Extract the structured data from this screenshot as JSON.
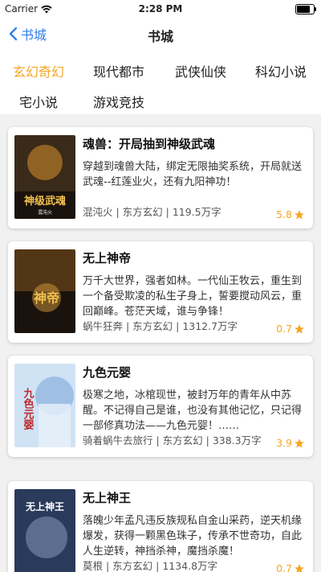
{
  "status": {
    "carrier": "Carrier",
    "time": "2:28 PM",
    "battery_level": 0.9
  },
  "nav": {
    "back_label": "书城",
    "title": "书城"
  },
  "categories": [
    {
      "label": "玄幻奇幻",
      "active": true
    },
    {
      "label": "现代都市",
      "active": false
    },
    {
      "label": "武侠仙侠",
      "active": false
    },
    {
      "label": "科幻小说",
      "active": false
    },
    {
      "label": "宅小说",
      "active": false
    },
    {
      "label": "游戏竞技",
      "active": false
    }
  ],
  "books": [
    {
      "title": "魂兽：开局抽到神级武魂",
      "desc": "穿越到魂兽大陆，绑定无限抽奖系统，开局就送武魂--红莲业火，还有九阳神功！",
      "meta": "混沌火 | 东方玄幻 | 119.5万字",
      "rating": "5.8",
      "cover_text": "神级武魂",
      "cover_author": "混沌火",
      "cover_colors": [
        "#3a2a1a",
        "#c9882a"
      ]
    },
    {
      "title": "无上神帝",
      "desc": "万千大世界，强者如林。一代仙王牧云，重生到一个备受欺凌的私生子身上，誓要搅动风云，重回巅峰。苍茫天域，谁与争锋！",
      "meta": "蜗牛狂奔 | 东方玄幻 | 1312.7万字",
      "rating": "0.7",
      "cover_text": "神帝",
      "cover_author": "",
      "cover_colors": [
        "#1a120c",
        "#8a5a20"
      ]
    },
    {
      "title": "九色元婴",
      "desc": "极寒之地，冰棺现世，被封万年的青年从中苏醒。不记得自己是谁，也没有其他记忆，只记得一部修真功法——九色元婴！……",
      "meta": "骑着蜗牛去旅行 | 东方玄幻 | 338.3万字",
      "rating": "3.9",
      "cover_text": "九色元婴",
      "cover_author": "",
      "cover_colors": [
        "#cfe3f5",
        "#7fa9d8"
      ]
    },
    {
      "title": "无上神王",
      "desc": "落魄少年孟凡违反族规私自金山采药，逆天机缘爆发，获得一颗黑色珠子，传承不世奇功，自此人生逆转，神挡杀神，魔挡杀魔！",
      "meta": "莫根 | 东方玄幻 | 1134.8万字",
      "rating": "0.7",
      "cover_text": "无上神王",
      "cover_author": "",
      "cover_colors": [
        "#2a3a5a",
        "#9ab0d0"
      ]
    }
  ]
}
